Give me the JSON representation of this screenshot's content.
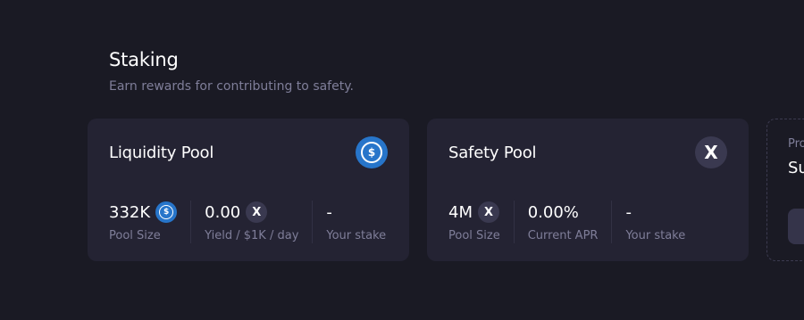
{
  "page": {
    "title": "Staking",
    "subtitle": "Earn rewards for contributing to safety."
  },
  "liquidity_pool": {
    "title": "Liquidity Pool",
    "logo_icon": "usdc-icon",
    "pool_size_value": "332K",
    "pool_size_label": "Pool Size",
    "yield_value": "0.00",
    "yield_label": "Yield / $1K / day",
    "stake_value": "-",
    "stake_label": "Your stake"
  },
  "safety_pool": {
    "title": "Safety Pool",
    "logo_icon": "dydx-icon",
    "pool_size_value": "4M",
    "pool_size_label": "Pool Size",
    "apr_value": "0.00%",
    "apr_label": "Current APR",
    "stake_value": "-",
    "stake_label": "Your stake"
  },
  "promo_card": {
    "label": "Pro",
    "title": "Su"
  },
  "colors": {
    "background": "#1a1a24",
    "card": "#242333",
    "muted_text": "#7f7e99",
    "usdc_blue": "#2775ca"
  }
}
